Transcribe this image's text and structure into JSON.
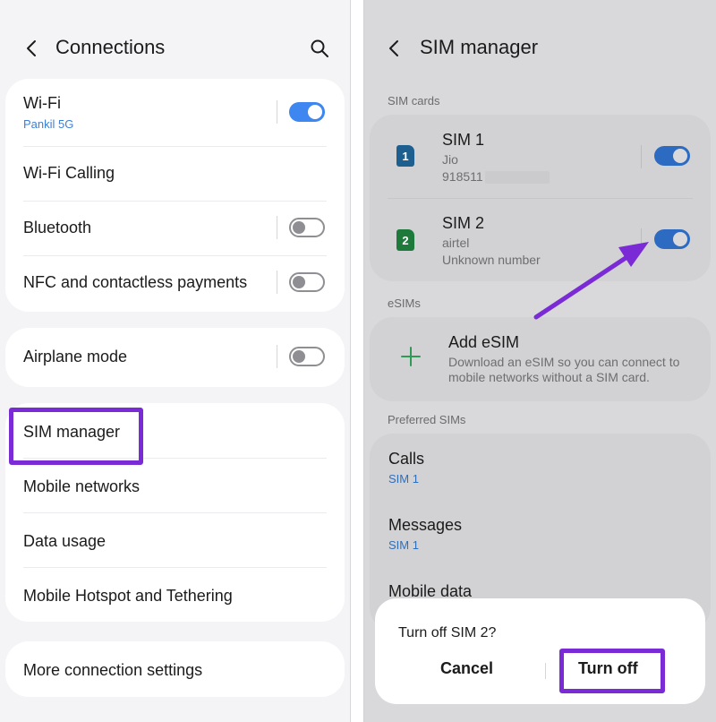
{
  "connections": {
    "title": "Connections",
    "wifi": {
      "label": "Wi-Fi",
      "network": "Pankil 5G",
      "enabled": true
    },
    "wifi_calling": {
      "label": "Wi-Fi Calling"
    },
    "bluetooth": {
      "label": "Bluetooth",
      "enabled": false
    },
    "nfc": {
      "label": "NFC and contactless payments",
      "enabled": false
    },
    "airplane": {
      "label": "Airplane mode",
      "enabled": false
    },
    "sim_manager": {
      "label": "SIM manager"
    },
    "mobile_networks": {
      "label": "Mobile networks"
    },
    "data_usage": {
      "label": "Data usage"
    },
    "hotspot": {
      "label": "Mobile Hotspot and Tethering"
    },
    "more": {
      "label": "More connection settings"
    }
  },
  "sim_manager": {
    "title": "SIM manager",
    "section_sim_cards": "SIM cards",
    "sim1": {
      "badge": "1",
      "name": "SIM 1",
      "carrier": "Jio",
      "number": "918511",
      "enabled": true,
      "badge_color": "#1d5f8f"
    },
    "sim2": {
      "badge": "2",
      "name": "SIM 2",
      "carrier": "airtel",
      "number": "Unknown number",
      "enabled": true,
      "badge_color": "#1e7a3a"
    },
    "section_esims": "eSIMs",
    "add_esim": {
      "label": "Add eSIM",
      "description": "Download an eSIM so you can connect to mobile networks without a SIM card."
    },
    "section_preferred": "Preferred SIMs",
    "calls": {
      "label": "Calls",
      "value": "SIM 1"
    },
    "messages": {
      "label": "Messages",
      "value": "SIM 1"
    },
    "mobile_data": {
      "label": "Mobile data"
    }
  },
  "dialog": {
    "title": "Turn off SIM 2?",
    "cancel": "Cancel",
    "confirm": "Turn off"
  },
  "colors": {
    "accent": "#3e86f0",
    "highlight": "#7a2bd6",
    "link": "#3e7fd6"
  }
}
